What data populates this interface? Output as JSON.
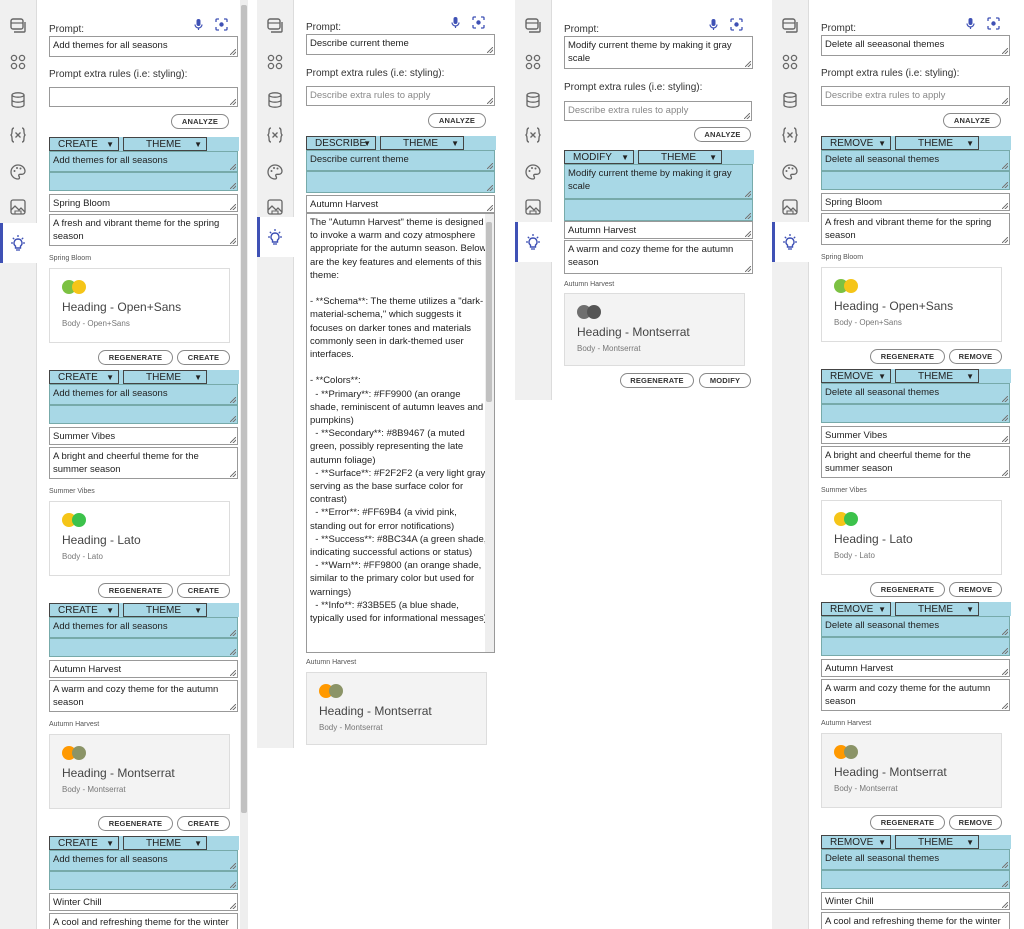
{
  "common": {
    "prompt_label": "Prompt:",
    "extra_label": "Prompt extra rules (i.e: styling):",
    "extra_placeholder": "Describe extra rules to apply",
    "analyze": "ANALYZE",
    "regenerate": "REGENERATE",
    "theme_select": "THEME"
  },
  "panel1": {
    "prompt": "Add themes for all seasons",
    "action": "CREATE",
    "confirm": "CREATE",
    "groups": [
      {
        "name": "Spring Bloom",
        "desc": "A fresh and vibrant theme for the spring season",
        "heading": "Heading - Open+Sans",
        "body": "Body - Open+Sans",
        "c1": "#7cc142",
        "c2": "#f5c518"
      },
      {
        "name": "Summer Vibes",
        "desc": "A bright and cheerful theme for the summer season",
        "heading": "Heading - Lato",
        "body": "Body - Lato",
        "c1": "#f5c518",
        "c2": "#3cc24b"
      },
      {
        "name": "Autumn Harvest",
        "desc": "A warm and cozy theme for the autumn season",
        "heading": "Heading - Montserrat",
        "body": "Body - Montserrat",
        "c1": "#FF9900",
        "c2": "#8B9467"
      },
      {
        "name": "Winter Chill",
        "desc": "A cool and refreshing theme for the winter season"
      }
    ]
  },
  "panel2": {
    "prompt": "Describe current theme",
    "action": "DESCRIBE",
    "name": "Autumn Harvest",
    "description": "The \"Autumn Harvest\" theme is designed to invoke a warm and cozy atmosphere appropriate for the autumn season. Below are the key features and elements of this theme:\n\n- **Schema**: The theme utilizes a \"dark-material-schema,\" which suggests it focuses on darker tones and materials commonly seen in dark-themed user interfaces.\n\n- **Colors**:\n  - **Primary**: #FF9900 (an orange shade, reminiscent of autumn leaves and pumpkins)\n  - **Secondary**: #8B9467 (a muted green, possibly representing the late autumn foliage)\n  - **Surface**: #F2F2F2 (a very light gray, serving as the base surface color for contrast)\n  - **Error**: #FF69B4 (a vivid pink, standing out for error notifications)\n  - **Success**: #8BC34A (a green shade, indicating successful actions or status)\n  - **Warn**: #FF9800 (an orange shade, similar to the primary color but used for warnings)\n  - **Info**: #33B5E5 (a blue shade, typically used for informational messages)",
    "heading": "Heading - Montserrat",
    "body": "Body - Montserrat",
    "c1": "#FF9900",
    "c2": "#8B9467"
  },
  "panel3": {
    "prompt": "Modify current theme by making it gray scale",
    "action": "MODIFY",
    "confirm": "MODIFY",
    "name": "Autumn Harvest",
    "desc": "A warm and cozy theme for the autumn season",
    "heading": "Heading - Montserrat",
    "body": "Body - Montserrat",
    "c1": "#6f6f6f",
    "c2": "#555555"
  },
  "panel4": {
    "prompt": "Delete all seeasonal themes",
    "action": "REMOVE",
    "confirm": "REMOVE",
    "group_prompt": "Delete all seasonal themes"
  }
}
